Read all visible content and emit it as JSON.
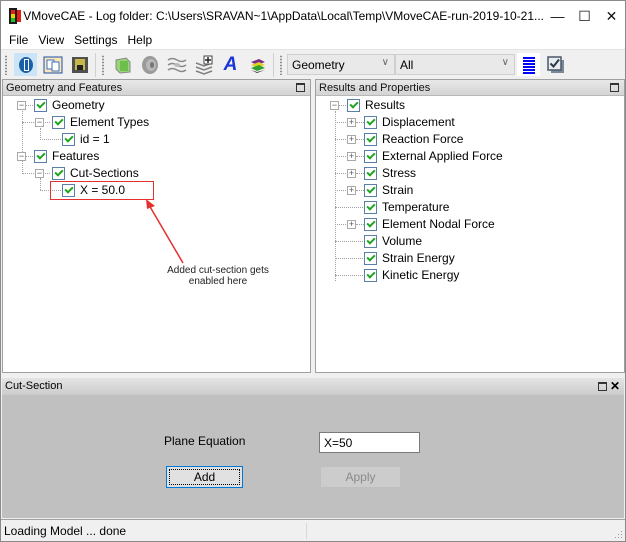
{
  "window": {
    "title": "VMoveCAE - Log folder: C:\\Users\\SRAVAN~1\\AppData\\Local\\Temp\\VMoveCAE-run-2019-10-21...",
    "minimize_label": "—",
    "maximize_label": "☐",
    "close_label": "✕"
  },
  "menu": {
    "items": [
      "File",
      "View",
      "Settings",
      "Help"
    ]
  },
  "toolbar": {
    "icons": [
      "open-file-icon",
      "copy-icon",
      "save-icon",
      "geometry-box-icon",
      "disc-icon",
      "wave-icon",
      "layers-add-icon",
      "text-a-icon",
      "stack-layers-icon",
      "lines-icon",
      "checkbox-icon"
    ],
    "text_icon_glyph": "A",
    "combo_type": {
      "value": "Geometry"
    },
    "combo_filter": {
      "value": "All"
    },
    "accent": "#0000ff"
  },
  "left_panel": {
    "title": "Geometry and Features",
    "tree": [
      {
        "label": "Geometry",
        "level": 0,
        "expander": "minus",
        "checked": true
      },
      {
        "label": "Element Types",
        "level": 1,
        "expander": "minus",
        "checked": true
      },
      {
        "label": "id = 1",
        "level": 2,
        "expander": "none",
        "checked": true
      },
      {
        "label": "Features",
        "level": 0,
        "expander": "minus",
        "checked": true
      },
      {
        "label": "Cut-Sections",
        "level": 1,
        "expander": "minus",
        "checked": true
      },
      {
        "label": "X = 50.0",
        "level": 2,
        "expander": "none",
        "checked": true
      }
    ],
    "annotation": "Added cut-section gets enabled here",
    "highlight_color": "#e53030"
  },
  "right_panel": {
    "title": "Results and Properties",
    "root": {
      "label": "Results",
      "expander": "minus",
      "checked": true
    },
    "items": [
      {
        "label": "Displacement",
        "expander": "plus",
        "checked": true
      },
      {
        "label": "Reaction Force",
        "expander": "plus",
        "checked": true
      },
      {
        "label": "External Applied Force",
        "expander": "plus",
        "checked": true
      },
      {
        "label": "Stress",
        "expander": "plus",
        "checked": true
      },
      {
        "label": "Strain",
        "expander": "plus",
        "checked": true
      },
      {
        "label": "Temperature",
        "expander": "none",
        "checked": true
      },
      {
        "label": "Element Nodal Force",
        "expander": "plus",
        "checked": true
      },
      {
        "label": "Volume",
        "expander": "none",
        "checked": true
      },
      {
        "label": "Strain Energy",
        "expander": "none",
        "checked": true
      },
      {
        "label": "Kinetic Energy",
        "expander": "none",
        "checked": true
      }
    ]
  },
  "cut_section": {
    "title": "Cut-Section",
    "plane_label": "Plane Equation",
    "plane_value": "X=50",
    "add_label": "Add",
    "apply_label": "Apply"
  },
  "status": {
    "text": "Loading Model ... done"
  }
}
